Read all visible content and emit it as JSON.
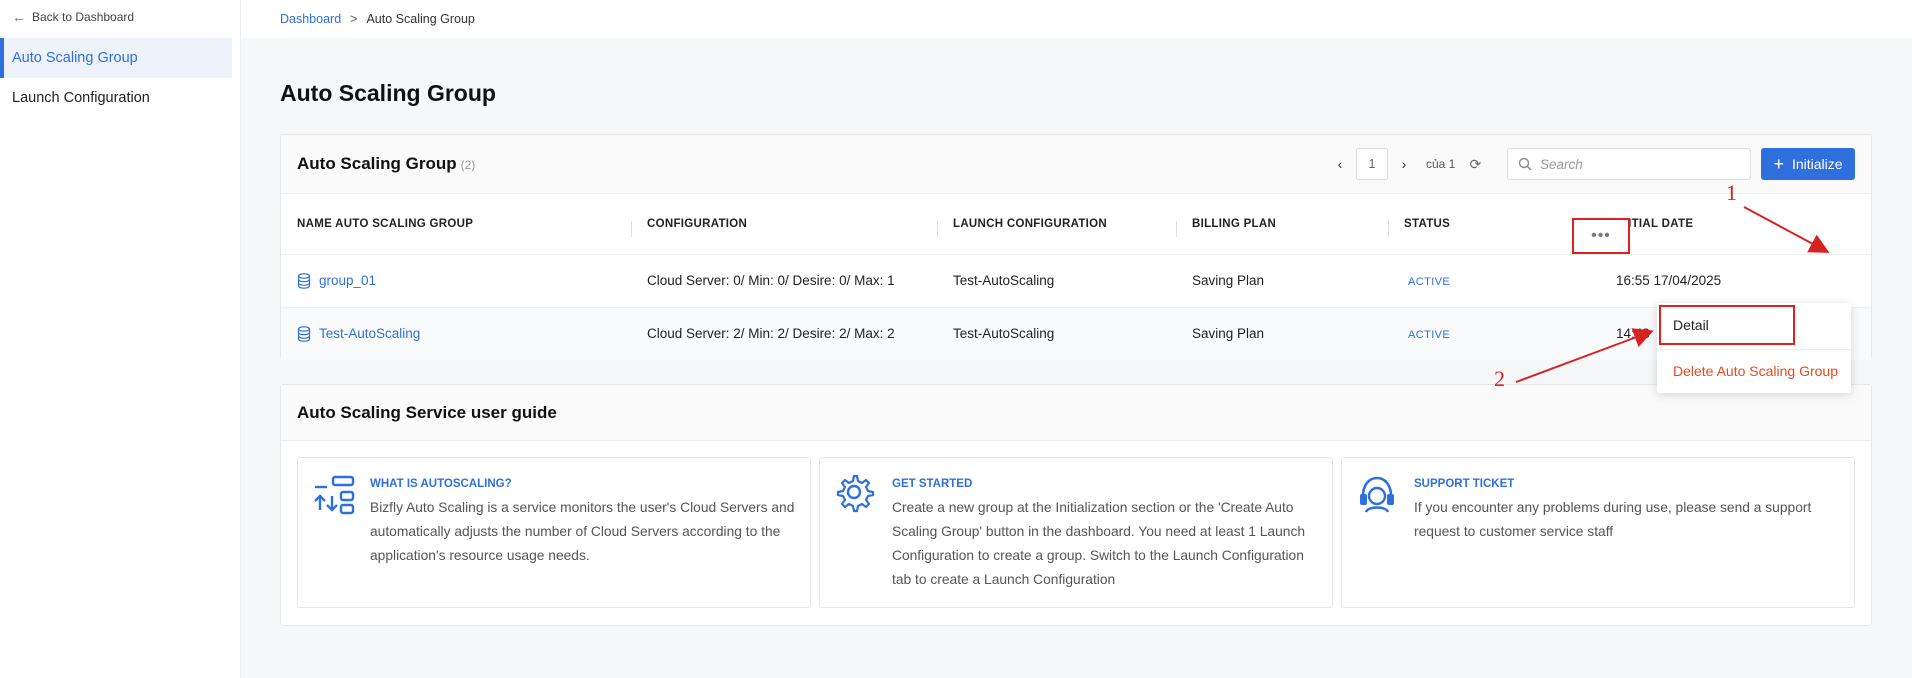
{
  "sidebar": {
    "back_label": "Back to Dashboard",
    "items": [
      {
        "label": "Auto Scaling Group"
      },
      {
        "label": "Launch Configuration"
      }
    ]
  },
  "breadcrumb": {
    "root": "Dashboard",
    "separator": ">",
    "current": "Auto Scaling Group"
  },
  "page": {
    "title": "Auto Scaling Group"
  },
  "group_card": {
    "title": "Auto Scaling Group",
    "count": "(2)",
    "pager": {
      "prev": "‹",
      "page": "1",
      "next": "›",
      "total": "của 1"
    },
    "search_placeholder": "Search",
    "init_label": "Initialize",
    "columns": [
      "NAME AUTO SCALING GROUP",
      "CONFIGURATION",
      "LAUNCH CONFIGURATION",
      "BILLING PLAN",
      "STATUS",
      "INITIAL DATE"
    ],
    "rows": [
      {
        "name": "group_01",
        "config": "Cloud Server: 0/ Min: 0/ Desire: 0/ Max: 1",
        "launch": "Test-AutoScaling",
        "billing": "Saving Plan",
        "status": "ACTIVE",
        "date": "16:55 17/04/2025"
      },
      {
        "name": "Test-AutoScaling",
        "config": "Cloud Server: 2/ Min: 2/ Desire: 2/ Max: 2",
        "launch": "Test-AutoScaling",
        "billing": "Saving Plan",
        "status": "ACTIVE",
        "date": "14:43"
      }
    ],
    "more_label": "•••",
    "menu": {
      "detail": "Detail",
      "delete": "Delete Auto Scaling Group"
    }
  },
  "guide_card": {
    "title": "Auto Scaling Service user guide",
    "items": [
      {
        "title": "WHAT IS AUTOSCALING?",
        "text": "Bizfly Auto Scaling is a service monitors the user's Cloud Servers and automatically adjusts the number of Cloud Servers according to the application's resource usage needs.",
        "icon": "autoscaling-icon"
      },
      {
        "title": "GET STARTED",
        "text": "Create a new group at the Initialization section or the 'Create Auto Scaling Group' button in the dashboard. You need at least 1 Launch Configuration to create a group. Switch to the Launch Configuration tab to create a Launch Configuration",
        "icon": "gear-icon"
      },
      {
        "title": "SUPPORT TICKET",
        "text": "If you encounter any problems during use, please send a support request to customer service staff",
        "icon": "headset-icon"
      }
    ]
  },
  "annotations": {
    "one": "1",
    "two": "2"
  },
  "colors": {
    "accent": "#2f6fde",
    "danger": "#e8491d",
    "annotation": "#d82222"
  }
}
